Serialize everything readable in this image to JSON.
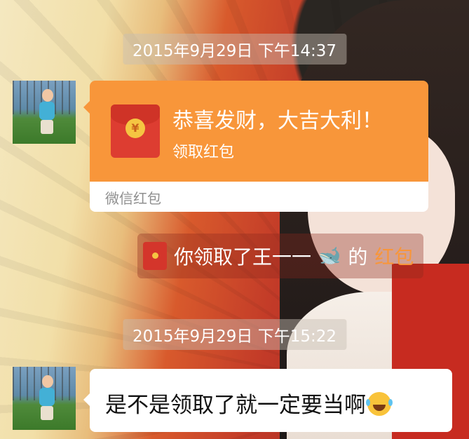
{
  "timestamps": [
    "2015年9月29日 下午14:37",
    "2015年9月29日 下午15:22"
  ],
  "red_packet": {
    "title": "恭喜发财，大吉大利！",
    "action": "领取红包",
    "footer": "微信红包",
    "coin_symbol": "¥",
    "color": "#f8963a"
  },
  "system_note": {
    "prefix": "你领取了王一一",
    "emoji": "🐋",
    "middle": "的",
    "link": "红包",
    "link_color": "#f8963a"
  },
  "message": {
    "text": "是不是领取了就一定要当啊",
    "emoji": "laughing-with-tears"
  }
}
